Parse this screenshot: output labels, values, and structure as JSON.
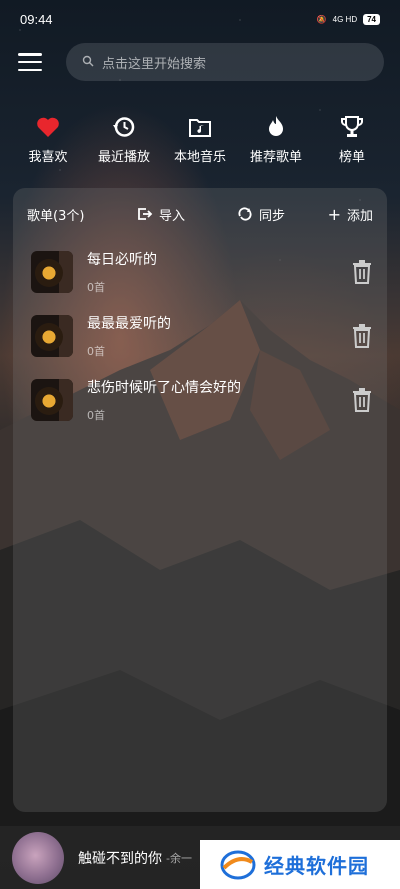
{
  "status_bar": {
    "time": "09:44",
    "network": "4G HD",
    "battery": "74"
  },
  "search": {
    "placeholder": "点击这里开始搜索"
  },
  "quick_actions": [
    {
      "label": "我喜欢",
      "icon": "heart-icon"
    },
    {
      "label": "最近播放",
      "icon": "history-icon"
    },
    {
      "label": "本地音乐",
      "icon": "folder-music-icon"
    },
    {
      "label": "推荐歌单",
      "icon": "flame-icon"
    },
    {
      "label": "榜单",
      "icon": "trophy-icon"
    }
  ],
  "playlist_panel": {
    "title": "歌单(3个)",
    "import_label": "导入",
    "sync_label": "同步",
    "add_label": "添加",
    "items": [
      {
        "name": "每日必听的",
        "count": "0首"
      },
      {
        "name": "最最最爱听的",
        "count": "0首"
      },
      {
        "name": "悲伤时候听了心情会好的",
        "count": "0首"
      }
    ]
  },
  "player": {
    "song": "触碰不到的你",
    "artist": "-余一"
  },
  "watermark": {
    "text": "经典软件园"
  },
  "colors": {
    "heart": "#e8262d",
    "watermark_blue": "#1e6fd9"
  }
}
